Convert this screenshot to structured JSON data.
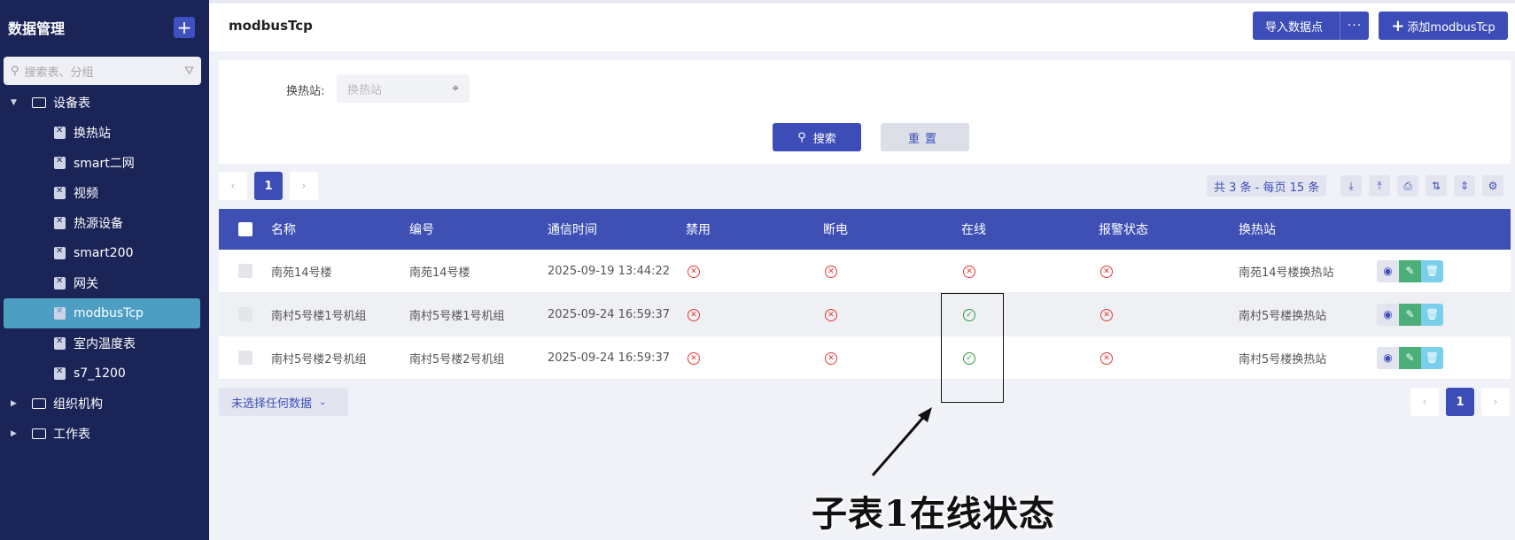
{
  "sidebar": {
    "title": "数据管理",
    "add_icon": "plus-icon",
    "search_placeholder": "搜索表、分组",
    "tree": [
      {
        "label": "设备表",
        "expanded": true,
        "children": [
          "换热站",
          "smart二网",
          "视频",
          "热源设备",
          "smart200",
          "网关",
          "modbusTcp",
          "室内温度表",
          "s7_1200"
        ]
      },
      {
        "label": "组织机构",
        "expanded": false
      },
      {
        "label": "工作表",
        "expanded": false
      }
    ],
    "active_item": "modbusTcp"
  },
  "header": {
    "title": "modbusTcp",
    "import_label": "导入数据点",
    "more_label": "···",
    "add_label": "添加modbusTcp"
  },
  "filter": {
    "station_label": "换热站:",
    "station_placeholder": "换热站",
    "search_label": "搜索",
    "reset_label": "重置"
  },
  "pager": {
    "current_page": "1",
    "prev": "‹",
    "next": "›",
    "total_text": "共 3 条 - 每页 15 条"
  },
  "table": {
    "columns": [
      "名称",
      "编号",
      "通信时间",
      "禁用",
      "断电",
      "在线",
      "报警状态",
      "换热站"
    ],
    "rows": [
      {
        "name": "南苑14号楼",
        "code": "南苑14号楼",
        "time": "2025-09-19 13:44:22",
        "disabled": "bad",
        "power_off": "bad",
        "online": "bad",
        "alarm": "bad",
        "station": "南苑14号楼换热站"
      },
      {
        "name": "南村5号楼1号机组",
        "code": "南村5号楼1号机组",
        "time": "2025-09-24 16:59:37",
        "disabled": "bad",
        "power_off": "bad",
        "online": "ok",
        "alarm": "bad",
        "station": "南村5号楼换热站"
      },
      {
        "name": "南村5号楼2号机组",
        "code": "南村5号楼2号机组",
        "time": "2025-09-24 16:59:37",
        "disabled": "bad",
        "power_off": "bad",
        "online": "ok",
        "alarm": "bad",
        "station": "南村5号楼换热站"
      }
    ]
  },
  "bottom": {
    "selection_label": "未选择任何数据"
  },
  "annotation": {
    "caption": "子表1在线状态"
  },
  "colors": {
    "sidebar_bg": "#1b2457",
    "primary": "#3d4db7",
    "active_item": "#4e9ec4",
    "ok": "#2e9b3f",
    "bad": "#e53935"
  }
}
